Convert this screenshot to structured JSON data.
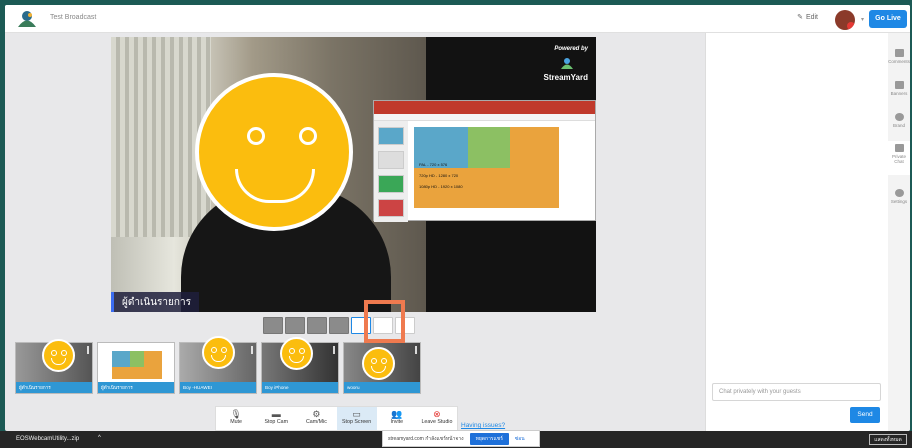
{
  "header": {
    "broadcast_title": "Test Broadcast",
    "edit_label": "Edit",
    "go_live_label": "Go Live"
  },
  "stage": {
    "powered_by": "Powered by",
    "brand_name": "StreamYard",
    "presenter_name": "ผู้ดำเนินรายการ",
    "screen_share": {
      "label_480": "PAL - 720 x 576",
      "label_720": "720p HD - 1280 x 720",
      "label_1080": "1080p HD - 1920 x 1080"
    }
  },
  "participants": [
    {
      "name": "ผู้ดำเนินรายการ"
    },
    {
      "name": "ผู้ดำเนินรายการ"
    },
    {
      "name": "Boy -HUAWEI"
    },
    {
      "name": "Boy iPhone"
    },
    {
      "name": "wooru"
    }
  ],
  "controls": [
    {
      "label": "Mute",
      "icon": "microphone-icon"
    },
    {
      "label": "Stop Cam",
      "icon": "camera-icon"
    },
    {
      "label": "Cam/Mic",
      "icon": "gear-icon"
    },
    {
      "label": "Stop Screen",
      "icon": "monitor-icon"
    },
    {
      "label": "Invite",
      "icon": "add-user-icon"
    },
    {
      "label": "Leave Studio",
      "icon": "close-circle-icon"
    }
  ],
  "having_issues": "Having issues?",
  "chat": {
    "placeholder": "Chat privately with your guests",
    "send_label": "Send"
  },
  "sidebar_rail": [
    {
      "label": "Comments",
      "icon": "comments-icon"
    },
    {
      "label": "Banners",
      "icon": "banners-icon"
    },
    {
      "label": "Brand",
      "icon": "palette-icon"
    },
    {
      "label": "Private Chat",
      "icon": "chat-icon"
    },
    {
      "label": "Settings",
      "icon": "gear-icon"
    }
  ],
  "taskbar": {
    "download_file": "EOSWebcamUtility...zip",
    "notice_text": "streamyard.com กำลังแชร์หน้าจาง",
    "notice_button": "หยุดการแชร์",
    "notice_hide": "ซ่อน",
    "right_button": "แสดงทั้งหมด"
  },
  "colors": {
    "accent": "#1e88e5",
    "highlight": "#ef7a4f",
    "smiley": "#fbbd0e"
  }
}
